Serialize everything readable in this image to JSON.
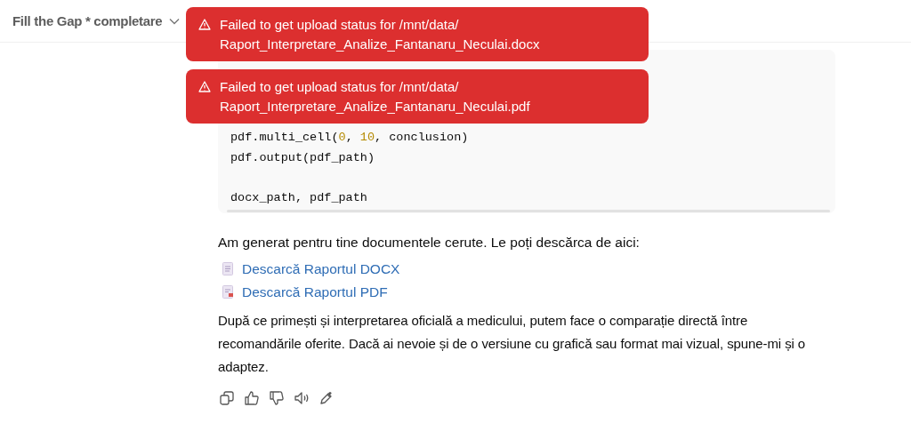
{
  "header": {
    "title": "Fill the Gap * completare"
  },
  "toasts": [
    {
      "lines": [
        "Failed to get upload status for /mnt/data/",
        "Raport_Interpretare_Analize_Fantanaru_Neculai.docx"
      ]
    },
    {
      "lines": [
        "Failed to get upload status for /mnt/data/",
        "Raport_Interpretare_Analize_Fantanaru_Neculai.pdf"
      ]
    }
  ],
  "code": {
    "lines": [
      {
        "tokens": [
          {
            "kind": "plain",
            "text": "pdf.multi_cell("
          },
          {
            "kind": "number",
            "text": "0"
          },
          {
            "kind": "plain",
            "text": ", "
          },
          {
            "kind": "number",
            "text": "10"
          },
          {
            "kind": "plain",
            "text": ", conclusion)"
          }
        ]
      },
      {
        "tokens": [
          {
            "kind": "plain",
            "text": "pdf.output(pdf_path)"
          }
        ]
      },
      {
        "kind": "blank"
      },
      {
        "tokens": [
          {
            "kind": "plain",
            "text": "docx_path, pdf_path"
          }
        ]
      }
    ]
  },
  "intro": "Am generat pentru tine documentele cerute. Le poți descărca de aici:",
  "links": [
    {
      "kind": "docx",
      "label": "Descarcă Raportul DOCX"
    },
    {
      "kind": "pdf",
      "label": "Descarcă Raportul PDF"
    }
  ],
  "paragraph": "După ce primești și interpretarea oficială a medicului, putem face o comparație directă între recomandările oferite. Dacă ai nevoie și de o versiune cu grafică sau format mai vizual, spune-mi și o adaptez.",
  "actions": [
    {
      "kind": "copy"
    },
    {
      "kind": "like"
    },
    {
      "kind": "dislike"
    },
    {
      "kind": "speak"
    },
    {
      "kind": "edit"
    }
  ]
}
